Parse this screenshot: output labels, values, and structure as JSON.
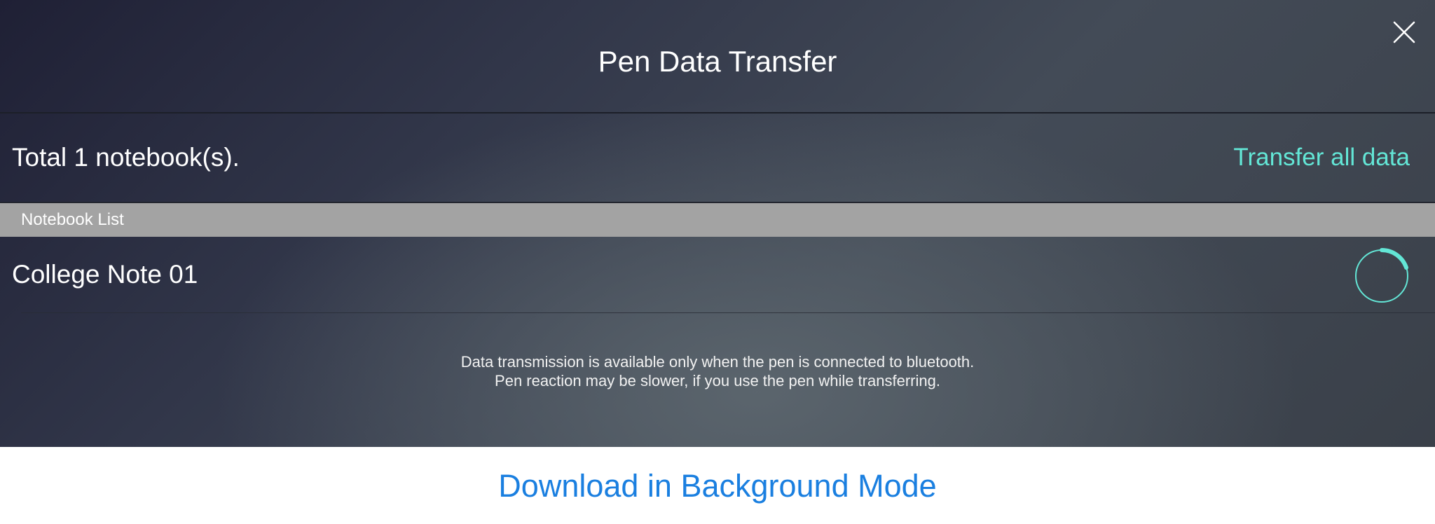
{
  "header": {
    "title": "Pen Data Transfer",
    "close_icon": "close-icon"
  },
  "summary": {
    "total_text": "Total 1 notebook(s).",
    "transfer_all_label": "Transfer all data",
    "accent_color": "#63e6d6"
  },
  "notebook_list": {
    "section_label": "Notebook List",
    "items": [
      {
        "name": "College Note 01",
        "status_icon": "loading-spinner-icon"
      }
    ]
  },
  "notice": {
    "line1": "Data transmission is available only when the pen is connected to bluetooth.",
    "line2": "Pen reaction may be slower, if you use the pen while transferring."
  },
  "bottom_bar": {
    "download_label": "Download in Background Mode",
    "link_color": "#1a7fe0"
  }
}
